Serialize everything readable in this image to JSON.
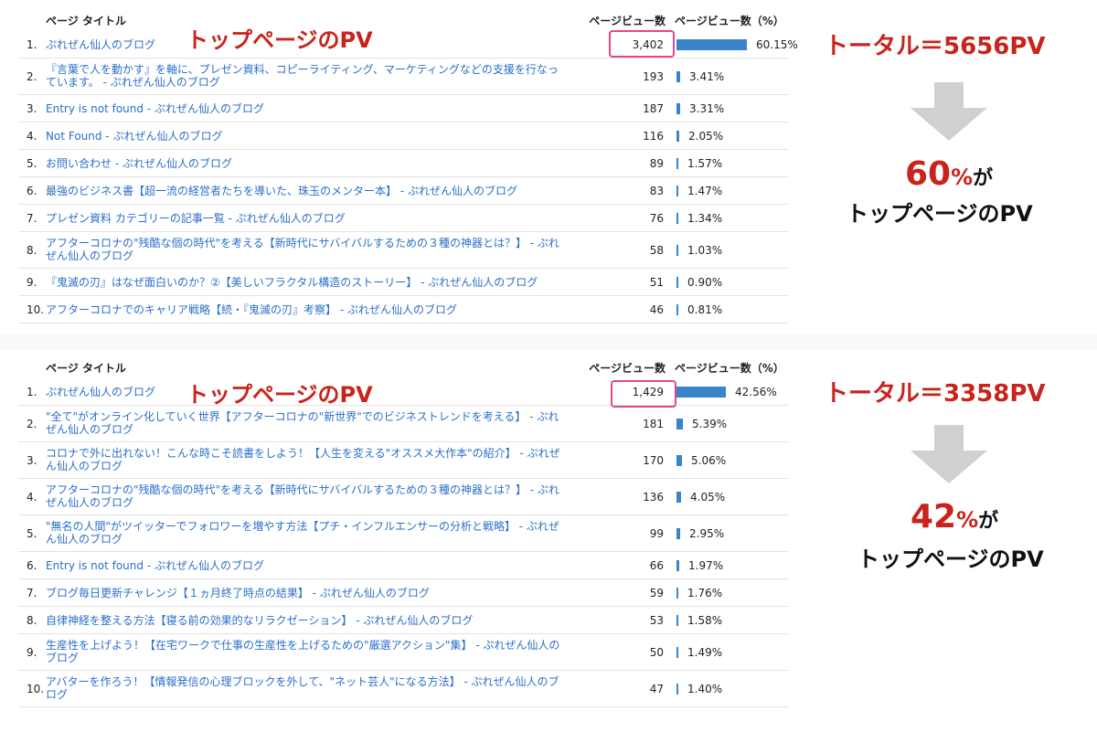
{
  "tables": [
    {
      "headers": {
        "title": "ページ タイトル",
        "pageviews": "ページビュー数",
        "percent": "ページビュー数（%）"
      },
      "rows": [
        {
          "num": "1.",
          "title": "ぷれぜん仙人のブログ",
          "pv": "3,402",
          "pct": "60.15%",
          "bar": 0.6015
        },
        {
          "num": "2.",
          "title": "『言葉で人を動かす』を軸に、プレゼン資料、コピーライティング、マーケティングなどの支援を行なっています。 - ぷれぜん仙人のブログ",
          "pv": "193",
          "pct": "3.41%",
          "bar": 0.0341
        },
        {
          "num": "3.",
          "title": "Entry is not found - ぷれぜん仙人のブログ",
          "pv": "187",
          "pct": "3.31%",
          "bar": 0.0331
        },
        {
          "num": "4.",
          "title": "Not Found - ぷれぜん仙人のブログ",
          "pv": "116",
          "pct": "2.05%",
          "bar": 0.0205
        },
        {
          "num": "5.",
          "title": "お問い合わせ - ぷれぜん仙人のブログ",
          "pv": "89",
          "pct": "1.57%",
          "bar": 0.0157
        },
        {
          "num": "6.",
          "title": "最強のビジネス書【超一流の経営者たちを導いた、珠玉のメンター本】 - ぷれぜん仙人のブログ",
          "pv": "83",
          "pct": "1.47%",
          "bar": 0.0147
        },
        {
          "num": "7.",
          "title": "プレゼン資料 カテゴリーの記事一覧 - ぷれぜん仙人のブログ",
          "pv": "76",
          "pct": "1.34%",
          "bar": 0.0134
        },
        {
          "num": "8.",
          "title": "アフターコロナの\"残酷な個の時代\"を考える【新時代にサバイバルするための３種の神器とは？】 - ぷれぜん仙人のブログ",
          "pv": "58",
          "pct": "1.03%",
          "bar": 0.0103
        },
        {
          "num": "9.",
          "title": "『鬼滅の刃』はなぜ面白いのか？②【美しいフラクタル構造のストーリー】 - ぷれぜん仙人のブログ",
          "pv": "51",
          "pct": "0.90%",
          "bar": 0.009
        },
        {
          "num": "10.",
          "title": "アフターコロナでのキャリア戦略【続・『鬼滅の刃』考察】 - ぷれぜん仙人のブログ",
          "pv": "46",
          "pct": "0.81%",
          "bar": 0.0081
        }
      ],
      "annotations": {
        "top_label": "トップページのPV",
        "total": "トータル＝5656PV",
        "share_pct": "60",
        "share_unit": "%",
        "share_ga": "が",
        "share_line2": "トップページのPV"
      }
    },
    {
      "headers": {
        "title": "ページ タイトル",
        "pageviews": "ページビュー数",
        "percent": "ページビュー数（%）"
      },
      "rows": [
        {
          "num": "1.",
          "title": "ぷれぜん仙人のブログ",
          "pv": "1,429",
          "pct": "42.56%",
          "bar": 0.4256
        },
        {
          "num": "2.",
          "title": "\"全て\"がオンライン化していく世界【アフターコロナの\"新世界\"でのビジネストレンドを考える】 - ぷれぜん仙人のブログ",
          "pv": "181",
          "pct": "5.39%",
          "bar": 0.0539
        },
        {
          "num": "3.",
          "title": "コロナで外に出れない！こんな時こそ読書をしよう！【人生を変える\"オススメ大作本\"の紹介】 - ぷれぜん仙人のブログ",
          "pv": "170",
          "pct": "5.06%",
          "bar": 0.0506
        },
        {
          "num": "4.",
          "title": "アフターコロナの\"残酷な個の時代\"を考える【新時代にサバイバルするための３種の神器とは？】 - ぷれぜん仙人のブログ",
          "pv": "136",
          "pct": "4.05%",
          "bar": 0.0405
        },
        {
          "num": "5.",
          "title": "\"無名の人間\"がツイッターでフォロワーを増やす方法【プチ・インフルエンサーの分析と戦略】 - ぷれぜん仙人のブログ",
          "pv": "99",
          "pct": "2.95%",
          "bar": 0.0295
        },
        {
          "num": "6.",
          "title": "Entry is not found - ぷれぜん仙人のブログ",
          "pv": "66",
          "pct": "1.97%",
          "bar": 0.0197
        },
        {
          "num": "7.",
          "title": "ブログ毎日更新チャレンジ【１ヵ月終了時点の結果】 - ぷれぜん仙人のブログ",
          "pv": "59",
          "pct": "1.76%",
          "bar": 0.0176
        },
        {
          "num": "8.",
          "title": "自律神経を整える方法【寝る前の効果的なリラクゼーション】 - ぷれぜん仙人のブログ",
          "pv": "53",
          "pct": "1.58%",
          "bar": 0.0158
        },
        {
          "num": "9.",
          "title": "生産性を上げよう！【在宅ワークで仕事の生産性を上げるための\"厳選アクション\"集】 - ぷれぜん仙人のブログ",
          "pv": "50",
          "pct": "1.49%",
          "bar": 0.0149
        },
        {
          "num": "10.",
          "title": "アバターを作ろう！【情報発信の心理ブロックを外して、\"ネット芸人\"になる方法】 - ぷれぜん仙人のブログ",
          "pv": "47",
          "pct": "1.40%",
          "bar": 0.014
        }
      ],
      "annotations": {
        "top_label": "トップページのPV",
        "total": "トータル＝3358PV",
        "share_pct": "42",
        "share_unit": "%",
        "share_ga": "が",
        "share_line2": "トップページのPV"
      }
    }
  ],
  "colors": {
    "accent_red": "#c8241c",
    "highlight_pink": "#e8468a",
    "bar_blue": "#3a84c9",
    "link_blue": "#2a6fc9"
  }
}
